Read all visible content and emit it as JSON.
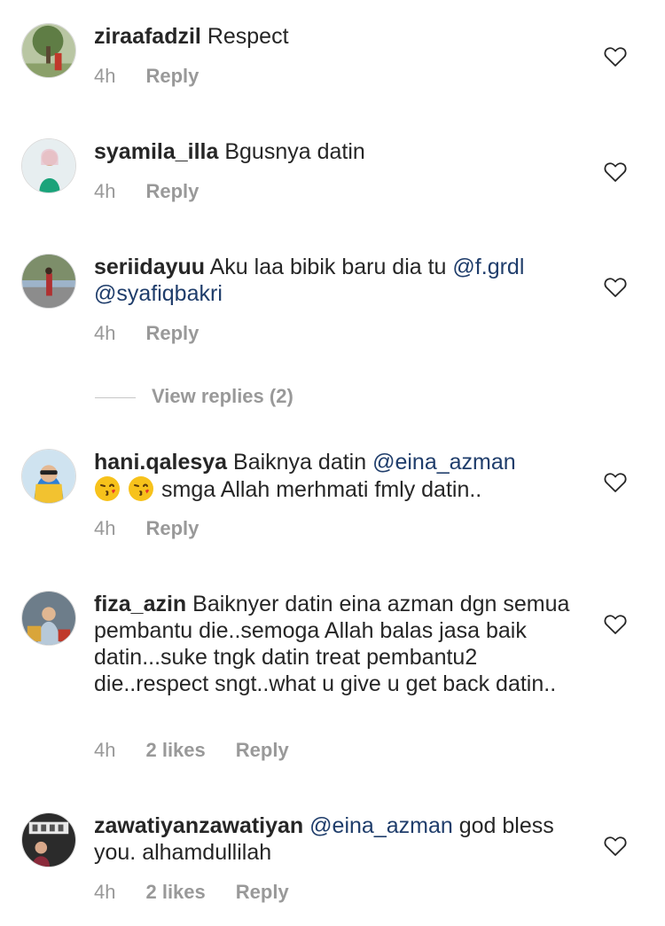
{
  "comments": [
    {
      "username": "ziraafadzil",
      "text": " Respect",
      "time": "4h",
      "reply": "Reply"
    },
    {
      "username": "syamila_illa",
      "text": " Bgusnya datin",
      "time": "4h",
      "reply": "Reply"
    },
    {
      "username": "seriidayuu",
      "text_before": " Aku laa bibik baru dia tu ",
      "mention1": "@f.grdl",
      "mention2": "@syafiqbakri",
      "time": "4h",
      "reply": "Reply"
    },
    {
      "username": "hani.qalesya",
      "text_before": " Baiknya datin ",
      "mention1": "@eina_azman",
      "text_after": "smga Allah merhmati fmly datin..",
      "emojis": [
        "kissing-face-emoji",
        "kissing-face-emoji"
      ],
      "time": "4h",
      "reply": "Reply"
    },
    {
      "username": "fiza_azin",
      "text": " Baiknyer datin eina azman dgn semua pembantu die..semoga Allah balas jasa baik datin...suke tngk datin treat pembantu2 die..respect sngt..what u give u get back datin..",
      "time": "4h",
      "likes": "2 likes",
      "reply": "Reply"
    },
    {
      "username": "zawatiyanzawatiyan",
      "text_before": " ",
      "mention1": "@eina_azman",
      "text_after": " god bless you. alhamdullilah",
      "time": "4h",
      "likes": "2 likes",
      "reply": "Reply"
    }
  ],
  "view_replies": "View replies (2)",
  "icons": {
    "like": "heart-outline-icon",
    "emoji": "kissing-face-emoji"
  },
  "colors": {
    "text": "#262626",
    "meta": "#999999",
    "mention": "#1f3d6b"
  }
}
